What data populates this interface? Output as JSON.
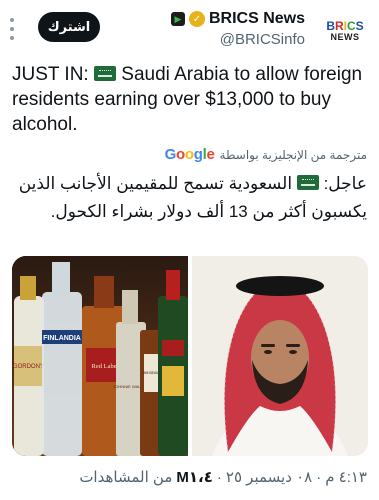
{
  "header": {
    "subscribe_label": "اشترك",
    "account_name": "BRICS News",
    "handle": "@BRICSinfo",
    "avatar_top": [
      "B",
      "R",
      "I",
      "C",
      "S"
    ],
    "avatar_bottom": "NEWS"
  },
  "tweet": {
    "prefix": "JUST IN:",
    "body": "Saudi Arabia to allow foreign residents earning over $13,000 to buy alcohol."
  },
  "translation": {
    "label": "مترجمة من الإنجليزية بواسطة",
    "brand_letters": [
      "G",
      "o",
      "o",
      "g",
      "l",
      "e"
    ],
    "prefix": "عاجل:",
    "body": "السعودية تسمح للمقيمين الأجانب الذين يكسبون أكثر من 13 ألف دولار بشراء الكحول."
  },
  "media": {
    "left_labels": [
      "GORDON'S",
      "FINLANDIA",
      "Red Label",
      "JOHNNIE WALKER",
      "JIM BEAM"
    ]
  },
  "footer": {
    "time": "٤:١٣ م",
    "date": "٠٨ ديسمبر ٢٥",
    "views_count": "M١،٤",
    "views_label": "من المشاهدات"
  },
  "colors": {
    "accent": "#0f1419",
    "muted": "#536471",
    "verified": "#e8b21a"
  }
}
